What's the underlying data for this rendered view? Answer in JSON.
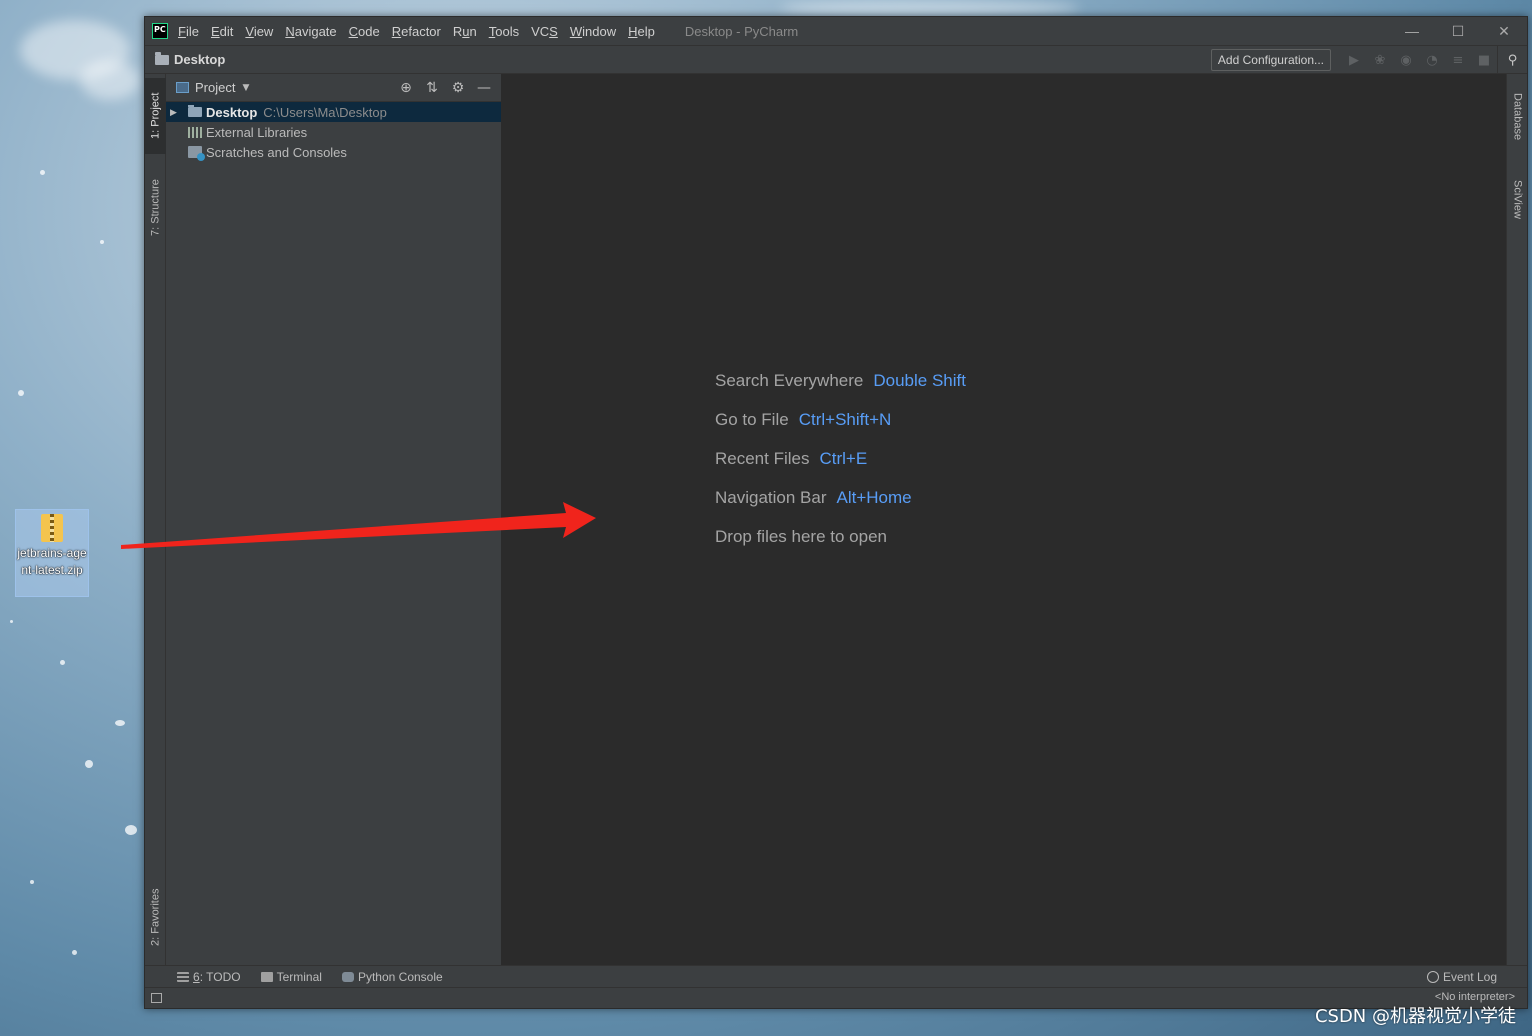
{
  "desktop": {
    "icon_label": "jetbrains-agent-latest.zip"
  },
  "window": {
    "title": "Desktop - PyCharm",
    "menu": [
      {
        "pre": "",
        "ul": "F",
        "post": "ile"
      },
      {
        "pre": "",
        "ul": "E",
        "post": "dit"
      },
      {
        "pre": "",
        "ul": "V",
        "post": "iew"
      },
      {
        "pre": "",
        "ul": "N",
        "post": "avigate"
      },
      {
        "pre": "",
        "ul": "C",
        "post": "ode"
      },
      {
        "pre": "",
        "ul": "R",
        "post": "efactor"
      },
      {
        "pre": "R",
        "ul": "u",
        "post": "n"
      },
      {
        "pre": "",
        "ul": "T",
        "post": "ools"
      },
      {
        "pre": "VC",
        "ul": "S",
        "post": ""
      },
      {
        "pre": "",
        "ul": "W",
        "post": "indow"
      },
      {
        "pre": "",
        "ul": "H",
        "post": "elp"
      }
    ]
  },
  "navbar": {
    "crumb": "Desktop",
    "add_config": "Add Configuration..."
  },
  "left_tabs": {
    "project": "1: Project",
    "structure": "7: Structure",
    "favorites": "2: Favorites"
  },
  "right_tabs": {
    "database": "Database",
    "sciview": "SciView"
  },
  "project_panel": {
    "title": "Project",
    "tree": {
      "root_name": "Desktop",
      "root_path": "C:\\Users\\Ma\\Desktop",
      "ext_libs": "External Libraries",
      "scratches": "Scratches and Consoles"
    }
  },
  "editor": {
    "hints": [
      {
        "label": "Search Everywhere",
        "key": "Double Shift"
      },
      {
        "label": "Go to File",
        "key": "Ctrl+Shift+N"
      },
      {
        "label": "Recent Files",
        "key": "Ctrl+E"
      },
      {
        "label": "Navigation Bar",
        "key": "Alt+Home"
      },
      {
        "label": "Drop files here to open",
        "key": ""
      }
    ]
  },
  "bottom": {
    "todo_num": "6",
    "todo_rest": ": TODO",
    "terminal": "Terminal",
    "python_console": "Python Console",
    "event_log": "Event Log",
    "interpreter": "<No interpreter>"
  },
  "watermark": "CSDN @机器视觉小学徒",
  "colors": {
    "shortcut": "#589df6",
    "editor_bg": "#2b2b2b",
    "panel_bg": "#3c3f41",
    "selection": "#0d293e",
    "arrow": "#f0241c"
  }
}
